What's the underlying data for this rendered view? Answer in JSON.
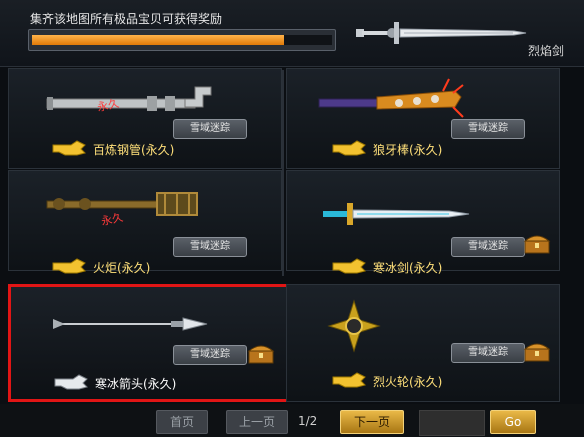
{
  "header": {
    "collect_text": "集齐该地图所有极品宝贝可获得奖励",
    "progress": 0.84,
    "reward_name": "烈焰剑"
  },
  "items": [
    {
      "name": "百炼钢管(永久)",
      "location": "雪域迷踪",
      "has_chest": false,
      "badge": "永久"
    },
    {
      "name": "狼牙棒(永久)",
      "location": "雪域迷踪",
      "has_chest": false,
      "badge": ""
    },
    {
      "name": "火炬(永久)",
      "location": "雪域迷踪",
      "has_chest": false,
      "badge": "永久"
    },
    {
      "name": "寒冰剑(永久)",
      "location": "雪域迷踪",
      "has_chest": true,
      "badge": ""
    },
    {
      "name": "寒冰箭头(永久)",
      "location": "雪域迷踪",
      "has_chest": true,
      "badge": ""
    },
    {
      "name": "烈火轮(永久)",
      "location": "雪域迷踪",
      "has_chest": true,
      "badge": ""
    }
  ],
  "pager": {
    "first": "首页",
    "prev": "上一页",
    "page": "1/2",
    "next": "下一页",
    "go": "Go",
    "input_value": ""
  },
  "colors": {
    "accent": "#e9b847",
    "highlight": "#e11515",
    "progress": "#f39a1e"
  }
}
